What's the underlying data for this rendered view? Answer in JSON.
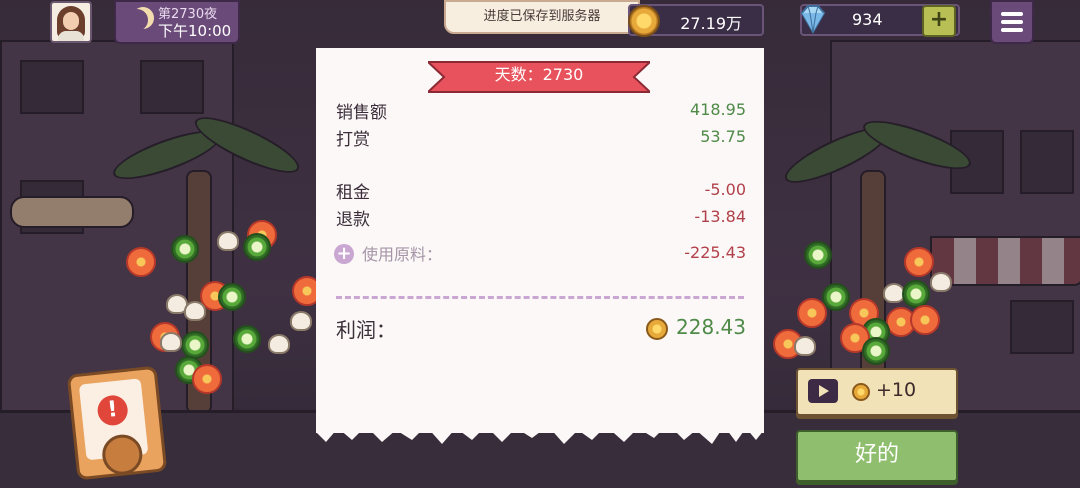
{
  "hud": {
    "night_label": "第2730夜",
    "time_label": "下午10:00",
    "save_toast": "进度已保存到服务器",
    "coins": "27.19万",
    "gems": "934",
    "gem_plus_label": "+"
  },
  "receipt": {
    "day_banner": "天数：2730",
    "rows": [
      {
        "label": "销售额",
        "value": "418.95"
      },
      {
        "label": "打赏",
        "value": "53.75"
      },
      {
        "label": "租金",
        "value": "-5.00"
      },
      {
        "label": "退款",
        "value": "-13.84"
      }
    ],
    "materials_icon": "+",
    "materials_label": "使用原料：",
    "materials_value": "-225.43",
    "profit_label": "利润：",
    "profit_value": "228.43"
  },
  "actions": {
    "ad_reward_label": "+10",
    "ok_label": "好的"
  },
  "alert": {
    "mark": "!"
  },
  "colors": {
    "positive": "#4f8a48",
    "negative": "#b2404a",
    "banner": "#e8525c",
    "ok_button": "#8fbf6e",
    "hud_purple": "#6a4a78"
  }
}
